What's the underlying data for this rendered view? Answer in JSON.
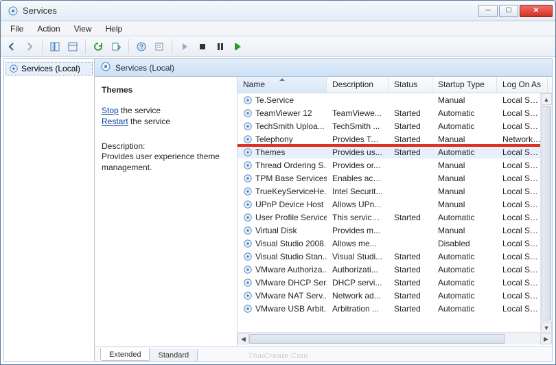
{
  "window": {
    "title": "Services"
  },
  "menu": {
    "file": "File",
    "action": "Action",
    "view": "View",
    "help": "Help"
  },
  "tree": {
    "root": "Services (Local)"
  },
  "header": {
    "label": "Services (Local)"
  },
  "detail": {
    "title": "Themes",
    "stop": "Stop",
    "stop_suffix": " the service",
    "restart": "Restart",
    "restart_suffix": " the service",
    "desc_label": "Description:",
    "desc_text": "Provides user experience theme management."
  },
  "columns": {
    "name": "Name",
    "desc": "Description",
    "status": "Status",
    "startup": "Startup Type",
    "logon": "Log On As"
  },
  "tabs": {
    "extended": "Extended",
    "standard": "Standard"
  },
  "watermark": "ThaiCreate.Com",
  "highlight_row_index": 4,
  "rows": [
    {
      "name": "Te.Service",
      "desc": "",
      "status": "",
      "startup": "Manual",
      "logon": "Local Syste..."
    },
    {
      "name": "TeamViewer 12",
      "desc": "TeamViewe...",
      "status": "Started",
      "startup": "Automatic",
      "logon": "Local Syste..."
    },
    {
      "name": "TechSmith Uploa...",
      "desc": "TechSmith ...",
      "status": "Started",
      "startup": "Automatic",
      "logon": "Local Syste..."
    },
    {
      "name": "Telephony",
      "desc": "Provides Tel...",
      "status": "Started",
      "startup": "Manual",
      "logon": "Network S..."
    },
    {
      "name": "Themes",
      "desc": "Provides us...",
      "status": "Started",
      "startup": "Automatic",
      "logon": "Local Syste..."
    },
    {
      "name": "Thread Ordering S...",
      "desc": "Provides or...",
      "status": "",
      "startup": "Manual",
      "logon": "Local Servic..."
    },
    {
      "name": "TPM Base Services",
      "desc": "Enables acc...",
      "status": "",
      "startup": "Manual",
      "logon": "Local Servic..."
    },
    {
      "name": "TrueKeyServiceHe...",
      "desc": "Intel Securit...",
      "status": "",
      "startup": "Manual",
      "logon": "Local Syste..."
    },
    {
      "name": "UPnP Device Host",
      "desc": "Allows UPn...",
      "status": "",
      "startup": "Manual",
      "logon": "Local Servic..."
    },
    {
      "name": "User Profile Service",
      "desc": "This service ...",
      "status": "Started",
      "startup": "Automatic",
      "logon": "Local Syste..."
    },
    {
      "name": "Virtual Disk",
      "desc": "Provides m...",
      "status": "",
      "startup": "Manual",
      "logon": "Local Syste..."
    },
    {
      "name": "Visual Studio 2008...",
      "desc": "Allows me...",
      "status": "",
      "startup": "Disabled",
      "logon": "Local Syste..."
    },
    {
      "name": "Visual Studio Stan...",
      "desc": "Visual Studi...",
      "status": "Started",
      "startup": "Automatic",
      "logon": "Local Syste..."
    },
    {
      "name": "VMware Authoriza...",
      "desc": "Authorizati...",
      "status": "Started",
      "startup": "Automatic",
      "logon": "Local Syste..."
    },
    {
      "name": "VMware DHCP Ser...",
      "desc": "DHCP servi...",
      "status": "Started",
      "startup": "Automatic",
      "logon": "Local Syste..."
    },
    {
      "name": "VMware NAT Serv...",
      "desc": "Network ad...",
      "status": "Started",
      "startup": "Automatic",
      "logon": "Local Syste..."
    },
    {
      "name": "VMware USB Arbit...",
      "desc": "Arbitration ...",
      "status": "Started",
      "startup": "Automatic",
      "logon": "Local Syste..."
    }
  ]
}
